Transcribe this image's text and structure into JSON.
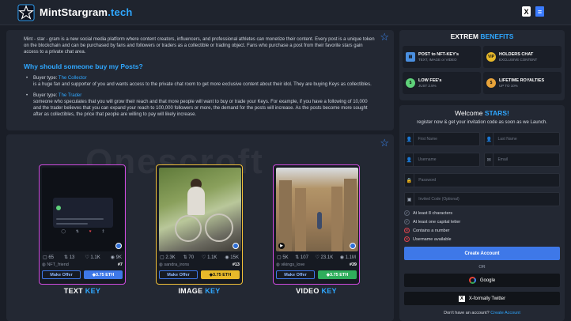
{
  "header": {
    "logo_main": "MintStargram",
    "logo_tld": ".tech",
    "icons": [
      "x-icon",
      "document-icon"
    ]
  },
  "intro": {
    "paragraph": "Mint - star - gram is a new social media platform where content creators, influencers, and professional athletes can monetize their content. Every post is a unique token on the blockchain and can be purchased by fans and followers or traders as a collectible or trading object. Fans who purchase a post from their favorite stars gain access to a private chat area.",
    "heading": "Why should someone buy my Posts?",
    "buyers": [
      {
        "prefix": "Buyer type: ",
        "type": "The Collector",
        "desc": "is a huge fan and supporter of you and wants access to the private chat room to get more exclusive content about their idol. They are buying Keys as collectibles."
      },
      {
        "prefix": "Buyer type: ",
        "type": "The Trader",
        "desc": "someone who speculates that you will grow their reach and that more people will want to buy or trade your Keys. For example, if you have a following of 10,000 and the trader believes that you can expand your reach to 100,000 followers or more, the demand for the posts will increase. As the posts become more sought after as collectibles, the price that people are willing to pay will likely increase."
      }
    ]
  },
  "showcase": {
    "watermark": "Onescroft",
    "cards": [
      {
        "label": "TEXT",
        "label_key": "KEY",
        "stats": {
          "views": "65",
          "reposts": "13",
          "likes": "1.1K",
          "comments": "9K"
        },
        "handle": "NFT_friend",
        "number": "#7",
        "offer_label": "Make Offer",
        "price": "3.75 ETH",
        "accent": "#d04be0"
      },
      {
        "label": "IMAGE",
        "label_key": "KEY",
        "stats": {
          "views": "2.3K",
          "reposts": "70",
          "likes": "1.1K",
          "comments": "15K"
        },
        "handle": "sandra_irons",
        "number": "#13",
        "offer_label": "Make Offer",
        "price": "3.75 ETH",
        "accent": "#f1c038"
      },
      {
        "label": "VIDEO",
        "label_key": "KEY",
        "stats": {
          "views": "5K",
          "reposts": "107",
          "likes": "23.1K",
          "comments": "1.1M"
        },
        "handle": "vikings_love",
        "number": "#39",
        "offer_label": "Make Offer",
        "price": "3.75 ETH",
        "accent": "#d04be0"
      }
    ]
  },
  "benefits": {
    "title_a": "EXTREM",
    "title_b": "BENEFITS",
    "items": [
      {
        "title": "POST to NFT-KEY's",
        "sub": "TEXT, IMAGE or VIDEO",
        "icon": "nft-icon",
        "color": "#4a8fe0"
      },
      {
        "title": "HOLDERS CHAT",
        "sub": "EXCLUSIVE CONTENT",
        "icon": "vip-icon",
        "color": "#e8b92a"
      },
      {
        "title": "LOW FEE's",
        "sub": "JUST 2.5%",
        "icon": "coin-icon",
        "color": "#5fd27a"
      },
      {
        "title": "LIFETIME ROYALTIES",
        "sub": "UP TO 10%",
        "icon": "moneybag-icon",
        "color": "#e8a33a"
      }
    ]
  },
  "register": {
    "welcome": "Welcome",
    "welcome_accent": "STARS!",
    "subtitle": "register now & get your invitation code as soon as we Launch.",
    "placeholders": {
      "first_name": "First Name",
      "last_name": "Last Name",
      "username": "Username",
      "email": "Email",
      "password": "Password",
      "invited_code": "Invited Code (Optional)"
    },
    "rules": [
      {
        "text": "At least 8 characters",
        "ok": true
      },
      {
        "text": "At least one capital letter",
        "ok": true
      },
      {
        "text": "Contains a number",
        "ok": false
      },
      {
        "text": "Username available",
        "ok": false
      }
    ],
    "create_button": "Create Account",
    "or": "OR",
    "google": "Google",
    "x_login": "X-formally Twitter",
    "no_account": "Don't have an account?",
    "create_link": "Create Account"
  }
}
